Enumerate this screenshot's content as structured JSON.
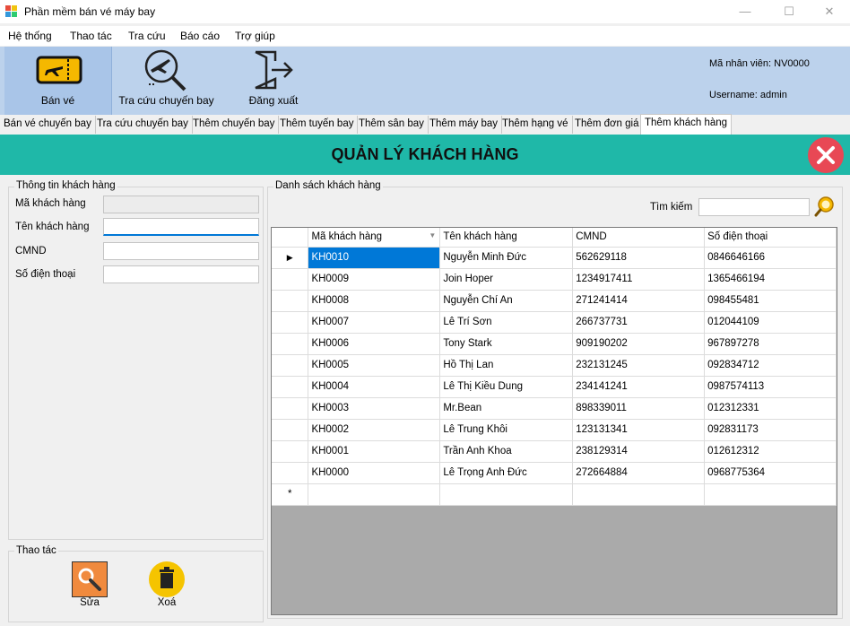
{
  "window": {
    "title": "Phần mềm bán vé máy bay",
    "minimize_glyph": "—",
    "maximize_glyph": "☐",
    "close_glyph": "✕"
  },
  "menu": [
    "Hệ thống",
    "Thao tác",
    "Tra cứu",
    "Báo cáo",
    "Trợ giúp"
  ],
  "toolbar": {
    "buttons": [
      {
        "label": "Bán vé",
        "icon": "ticket-icon"
      },
      {
        "label": "Tra cứu chuyến bay",
        "icon": "flight-search-icon"
      },
      {
        "label": "Đăng xuất",
        "icon": "logout-icon"
      }
    ],
    "employee_id": "Mã nhân viên: NV0000",
    "username": "Username: admin"
  },
  "tabs": [
    "Bán vé chuyến bay",
    "Tra cứu chuyến bay",
    "Thêm chuyến bay",
    "Thêm tuyến bay",
    "Thêm sân bay",
    "Thêm máy bay",
    "Thêm hạng vé",
    "Thêm đơn giá",
    "Thêm khách hàng"
  ],
  "active_tab": "Thêm khách hàng",
  "header": {
    "title": "QUẢN LÝ KHÁCH HÀNG",
    "accent": "#1fb8a8",
    "close_color": "#e84855"
  },
  "customer_info": {
    "title": "Thông tin khách hàng",
    "fields": [
      {
        "label": "Mã khách hàng",
        "value": ""
      },
      {
        "label": "Tên khách hàng",
        "value": ""
      },
      {
        "label": "CMND",
        "value": ""
      },
      {
        "label": "Số điện thoại",
        "value": ""
      }
    ]
  },
  "customer_list": {
    "title": "Danh sách khách hàng",
    "search_label": "Tìm kiếm",
    "search_value": "",
    "columns": [
      "Mã khách hàng",
      "Tên khách hàng",
      "CMND",
      "Số điện thoại"
    ],
    "rows": [
      [
        "KH0010",
        "Nguyễn Minh Đức",
        "562629118",
        "0846646166"
      ],
      [
        "KH0009",
        "Join Hoper",
        "1234917411",
        "1365466194"
      ],
      [
        "KH0008",
        "Nguyễn Chí An",
        "271241414",
        "098455481"
      ],
      [
        "KH0007",
        "Lê Trí Sơn",
        "266737731",
        "012044109"
      ],
      [
        "KH0006",
        "Tony Stark",
        "909190202",
        "967897278"
      ],
      [
        "KH0005",
        "Hồ Thị Lan",
        "232131245",
        "092834712"
      ],
      [
        "KH0004",
        "Lê Thị Kiều Dung",
        "234141241",
        "0987574113"
      ],
      [
        "KH0003",
        "Mr.Bean",
        "898339011",
        "012312331"
      ],
      [
        "KH0002",
        "Lê Trung Khôi",
        "123131341",
        "092831173"
      ],
      [
        "KH0001",
        "Trần Anh Khoa",
        "238129314",
        "012612312"
      ],
      [
        "KH0000",
        "Lê Trọng Anh Đức",
        "272664884",
        "0968775364"
      ]
    ],
    "current_row_marker": "▶",
    "new_row_marker": "*"
  },
  "actions": {
    "title": "Thao tác",
    "edit_label": "Sửa",
    "delete_label": "Xoá"
  }
}
